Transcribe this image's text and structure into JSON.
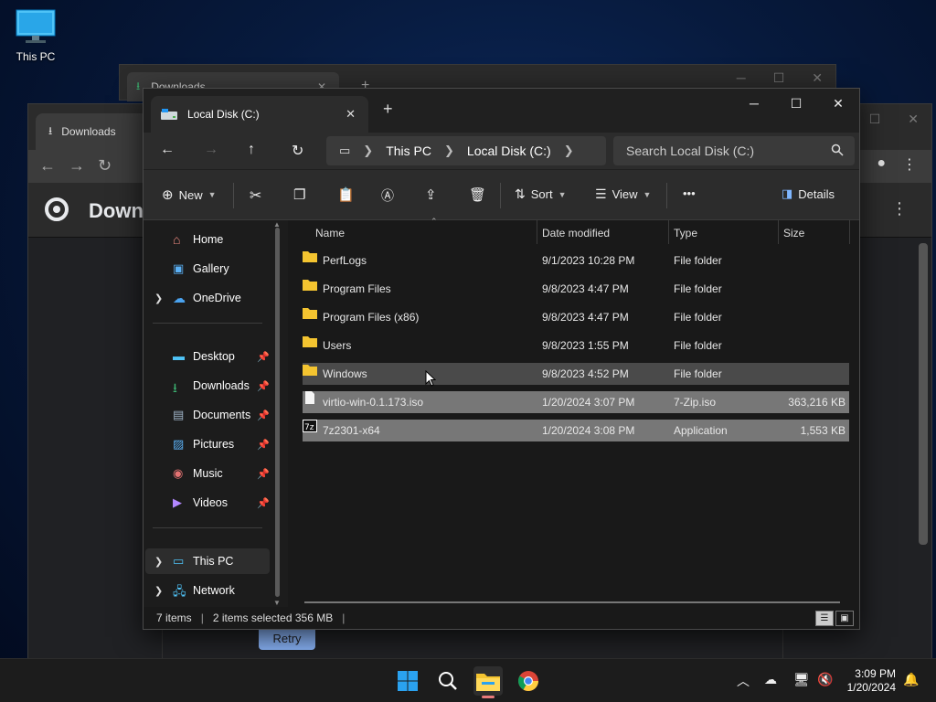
{
  "desktop": {
    "this_pc_label": "This PC"
  },
  "background_windows": {
    "explorer_tab": "Downloads",
    "chrome_tab": "Downloads",
    "chrome_page_title": "Down",
    "retry_label": "Retry"
  },
  "explorer": {
    "tab_title": "Local Disk (C:)",
    "breadcrumb": [
      "This PC",
      "Local Disk (C:)"
    ],
    "search_placeholder": "Search Local Disk (C:)",
    "commands": {
      "new": "New",
      "sort": "Sort",
      "view": "View",
      "more": "•••",
      "details": "Details"
    },
    "nav": {
      "home": "Home",
      "gallery": "Gallery",
      "onedrive": "OneDrive",
      "desktop": "Desktop",
      "downloads": "Downloads",
      "documents": "Documents",
      "pictures": "Pictures",
      "music": "Music",
      "videos": "Videos",
      "thispc": "This PC",
      "network": "Network"
    },
    "columns": {
      "name": "Name",
      "date": "Date modified",
      "type": "Type",
      "size": "Size"
    },
    "files": [
      {
        "name": "PerfLogs",
        "date": "9/1/2023 10:28 PM",
        "type": "File folder",
        "size": ""
      },
      {
        "name": "Program Files",
        "date": "9/8/2023 4:47 PM",
        "type": "File folder",
        "size": ""
      },
      {
        "name": "Program Files (x86)",
        "date": "9/8/2023 4:47 PM",
        "type": "File folder",
        "size": ""
      },
      {
        "name": "Users",
        "date": "9/8/2023 1:55 PM",
        "type": "File folder",
        "size": ""
      },
      {
        "name": "Windows",
        "date": "9/8/2023 4:52 PM",
        "type": "File folder",
        "size": ""
      },
      {
        "name": "virtio-win-0.1.173.iso",
        "date": "1/20/2024 3:07 PM",
        "type": "7-Zip.iso",
        "size": "363,216 KB"
      },
      {
        "name": "7z2301-x64",
        "date": "1/20/2024 3:08 PM",
        "type": "Application",
        "size": "1,553 KB"
      }
    ],
    "status": {
      "count": "7 items",
      "selected": "2 items selected 356 MB"
    }
  },
  "taskbar": {
    "time": "3:09 PM",
    "date": "1/20/2024"
  },
  "colors": {
    "folder": "#f4c430",
    "accent": "#0a78d4",
    "selection": "#777777"
  }
}
